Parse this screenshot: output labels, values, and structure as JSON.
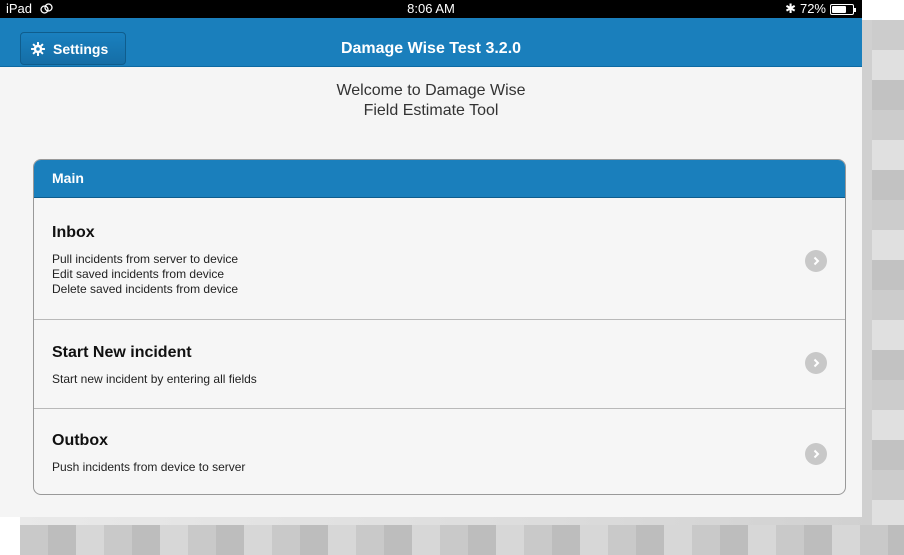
{
  "status_bar": {
    "device": "iPad",
    "time": "8:06 AM",
    "bluetooth": "✱",
    "battery_percent": "72%",
    "battery_level": 0.72,
    "icons": [
      "wifi-icon",
      "bluetooth-icon",
      "battery-icon"
    ]
  },
  "header": {
    "settings_label": "Settings",
    "settings_icon": "gear-icon",
    "title": "Damage Wise Test 3.2.0"
  },
  "welcome": {
    "line1": "Welcome to Damage Wise",
    "line2": "Field Estimate Tool"
  },
  "main": {
    "section_label": "Main",
    "items": [
      {
        "title": "Inbox",
        "lines": [
          "Pull incidents from server to device",
          "Edit saved incidents from device",
          "Delete saved incidents from device"
        ]
      },
      {
        "title": "Start New incident",
        "lines": [
          "Start new incident by entering all fields"
        ]
      },
      {
        "title": "Outbox",
        "lines": [
          "Push incidents from device to server"
        ]
      }
    ]
  },
  "colors": {
    "accent": "#1a7fbc",
    "background": "#f5f5f5",
    "chevron": "#c8c8c8"
  }
}
